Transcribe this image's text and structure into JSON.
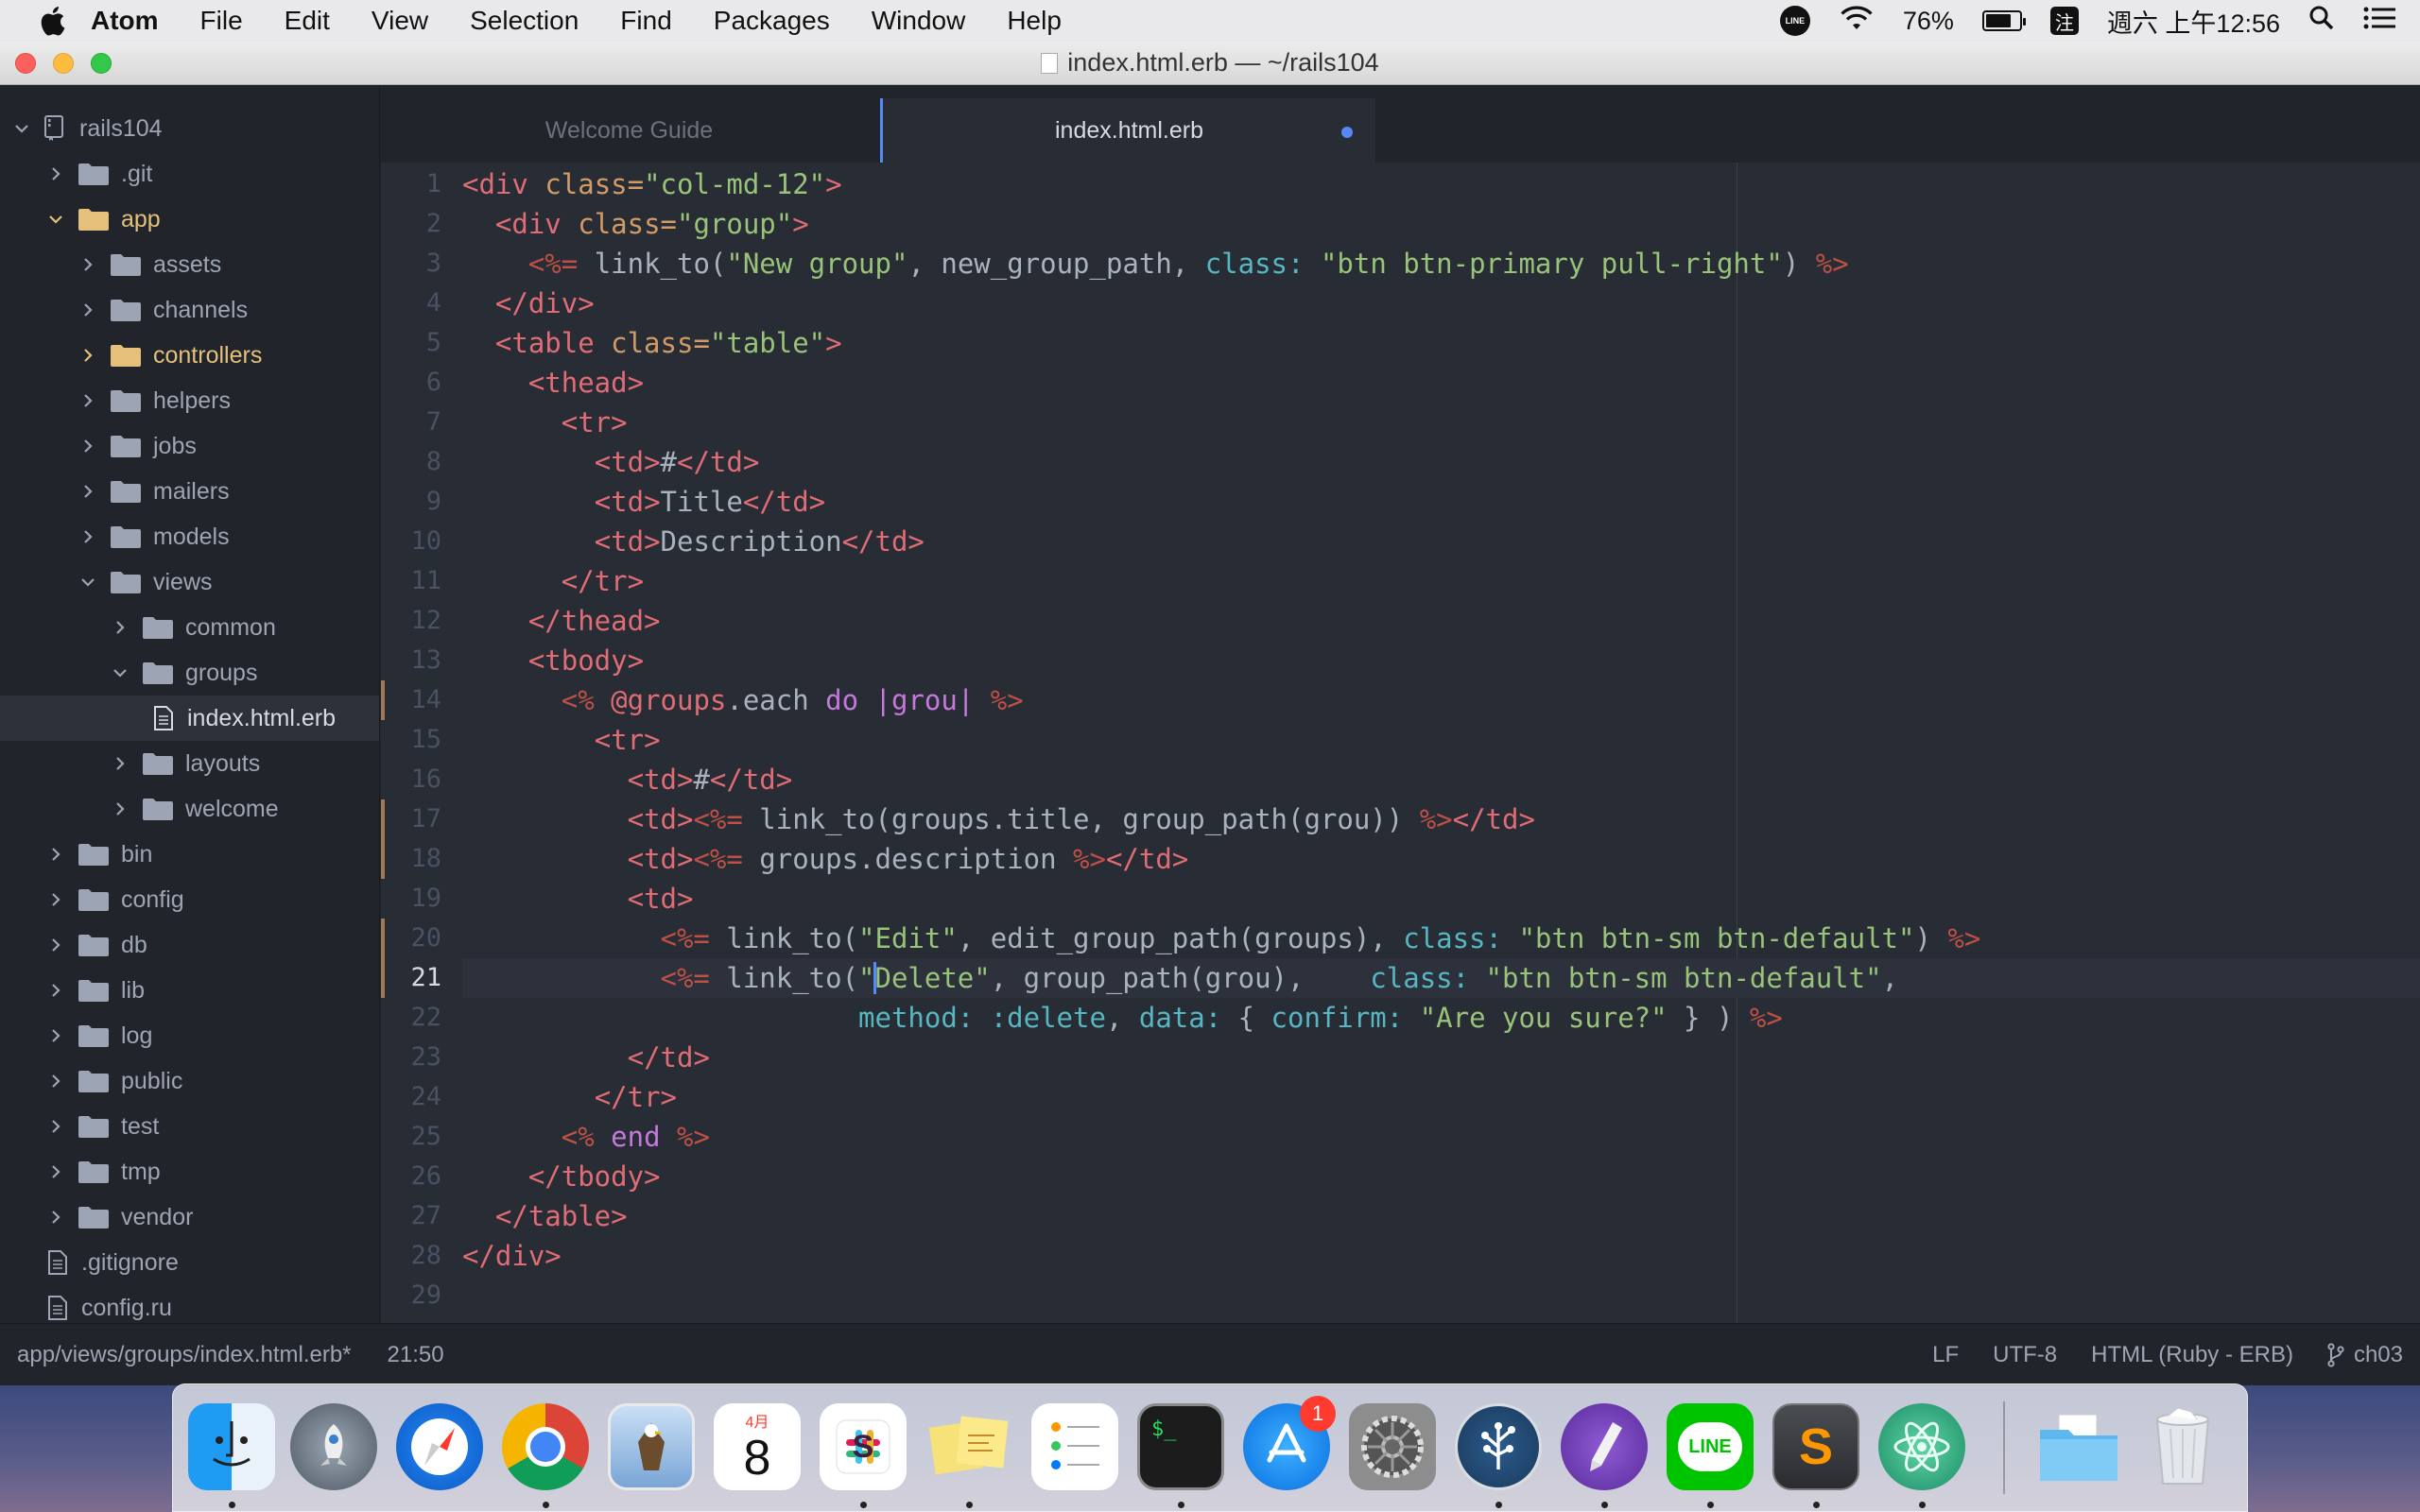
{
  "menubar": {
    "app_name": "Atom",
    "items": [
      "File",
      "Edit",
      "View",
      "Selection",
      "Find",
      "Packages",
      "Window",
      "Help"
    ],
    "status": {
      "line_icon": "LINE",
      "battery": "76%",
      "battery_level": 0.76,
      "ime": "注",
      "datetime": "週六 上午12:56"
    }
  },
  "window": {
    "title": "index.html.erb — ~/rails104"
  },
  "tree": {
    "root": "rails104",
    "items": [
      {
        "label": ".git",
        "depth": 1,
        "kind": "folder",
        "expanded": false
      },
      {
        "label": "app",
        "depth": 1,
        "kind": "folder",
        "expanded": true,
        "modified": true
      },
      {
        "label": "assets",
        "depth": 2,
        "kind": "folder",
        "expanded": false
      },
      {
        "label": "channels",
        "depth": 2,
        "kind": "folder",
        "expanded": false
      },
      {
        "label": "controllers",
        "depth": 2,
        "kind": "folder",
        "expanded": false,
        "modified": true
      },
      {
        "label": "helpers",
        "depth": 2,
        "kind": "folder",
        "expanded": false
      },
      {
        "label": "jobs",
        "depth": 2,
        "kind": "folder",
        "expanded": false
      },
      {
        "label": "mailers",
        "depth": 2,
        "kind": "folder",
        "expanded": false
      },
      {
        "label": "models",
        "depth": 2,
        "kind": "folder",
        "expanded": false
      },
      {
        "label": "views",
        "depth": 2,
        "kind": "folder",
        "expanded": true
      },
      {
        "label": "common",
        "depth": 3,
        "kind": "folder",
        "expanded": false
      },
      {
        "label": "groups",
        "depth": 3,
        "kind": "folder",
        "expanded": true
      },
      {
        "label": "index.html.erb",
        "depth": 4,
        "kind": "file",
        "selected": true
      },
      {
        "label": "layouts",
        "depth": 3,
        "kind": "folder",
        "expanded": false
      },
      {
        "label": "welcome",
        "depth": 3,
        "kind": "folder",
        "expanded": false
      },
      {
        "label": "bin",
        "depth": 1,
        "kind": "folder",
        "expanded": false
      },
      {
        "label": "config",
        "depth": 1,
        "kind": "folder",
        "expanded": false
      },
      {
        "label": "db",
        "depth": 1,
        "kind": "folder",
        "expanded": false
      },
      {
        "label": "lib",
        "depth": 1,
        "kind": "folder",
        "expanded": false
      },
      {
        "label": "log",
        "depth": 1,
        "kind": "folder",
        "expanded": false
      },
      {
        "label": "public",
        "depth": 1,
        "kind": "folder",
        "expanded": false
      },
      {
        "label": "test",
        "depth": 1,
        "kind": "folder",
        "expanded": false
      },
      {
        "label": "tmp",
        "depth": 1,
        "kind": "folder",
        "expanded": false
      },
      {
        "label": "vendor",
        "depth": 1,
        "kind": "folder",
        "expanded": false
      },
      {
        "label": ".gitignore",
        "depth": 1,
        "kind": "file"
      },
      {
        "label": "config.ru",
        "depth": 1,
        "kind": "file"
      }
    ]
  },
  "tabs": [
    {
      "label": "Welcome Guide",
      "active": false
    },
    {
      "label": "index.html.erb",
      "active": true,
      "modified": true
    }
  ],
  "editor": {
    "current_line": 21,
    "cursor_col": 25,
    "modified_lines": [
      14,
      17,
      18,
      20,
      21
    ],
    "lines": [
      [
        [
          "t",
          "<div "
        ],
        [
          "a",
          "class="
        ],
        [
          "s",
          "\"col-md-12\""
        ],
        [
          "t",
          ">"
        ]
      ],
      [
        [
          "p",
          "  "
        ],
        [
          "t",
          "<div "
        ],
        [
          "a",
          "class="
        ],
        [
          "s",
          "\"group\""
        ],
        [
          "t",
          ">"
        ]
      ],
      [
        [
          "p",
          "    "
        ],
        [
          "e",
          "<%= "
        ],
        [
          "f",
          "link_to("
        ],
        [
          "s",
          "\"New group\""
        ],
        [
          "f",
          ", new_group_path, "
        ],
        [
          "sym",
          "class: "
        ],
        [
          "s",
          "\"btn btn-primary pull-right\""
        ],
        [
          "f",
          ") "
        ],
        [
          "e",
          "%>"
        ]
      ],
      [
        [
          "p",
          "  "
        ],
        [
          "t",
          "</div>"
        ]
      ],
      [
        [
          "p",
          "  "
        ],
        [
          "t",
          "<table "
        ],
        [
          "a",
          "class="
        ],
        [
          "s",
          "\"table\""
        ],
        [
          "t",
          ">"
        ]
      ],
      [
        [
          "p",
          "    "
        ],
        [
          "t",
          "<thead>"
        ]
      ],
      [
        [
          "p",
          "      "
        ],
        [
          "t",
          "<tr>"
        ]
      ],
      [
        [
          "p",
          "        "
        ],
        [
          "t",
          "<td>"
        ],
        [
          "p",
          "#"
        ],
        [
          "t",
          "</td>"
        ]
      ],
      [
        [
          "p",
          "        "
        ],
        [
          "t",
          "<td>"
        ],
        [
          "p",
          "Title"
        ],
        [
          "t",
          "</td>"
        ]
      ],
      [
        [
          "p",
          "        "
        ],
        [
          "t",
          "<td>"
        ],
        [
          "p",
          "Description"
        ],
        [
          "t",
          "</td>"
        ]
      ],
      [
        [
          "p",
          "      "
        ],
        [
          "t",
          "</tr>"
        ]
      ],
      [
        [
          "p",
          "    "
        ],
        [
          "t",
          "</thead>"
        ]
      ],
      [
        [
          "p",
          "    "
        ],
        [
          "t",
          "<tbody>"
        ]
      ],
      [
        [
          "p",
          "      "
        ],
        [
          "e",
          "<% "
        ],
        [
          "iv",
          "@groups"
        ],
        [
          "f",
          ".each "
        ],
        [
          "k",
          "do |grou| "
        ],
        [
          "e",
          "%>"
        ]
      ],
      [
        [
          "p",
          "        "
        ],
        [
          "t",
          "<tr>"
        ]
      ],
      [
        [
          "p",
          "          "
        ],
        [
          "t",
          "<td>"
        ],
        [
          "p",
          "#"
        ],
        [
          "t",
          "</td>"
        ]
      ],
      [
        [
          "p",
          "          "
        ],
        [
          "t",
          "<td>"
        ],
        [
          "e",
          "<%= "
        ],
        [
          "f",
          "link_to(groups.title, group_path(grou)) "
        ],
        [
          "e",
          "%>"
        ],
        [
          "t",
          "</td>"
        ]
      ],
      [
        [
          "p",
          "          "
        ],
        [
          "t",
          "<td>"
        ],
        [
          "e",
          "<%= "
        ],
        [
          "f",
          "groups.description "
        ],
        [
          "e",
          "%>"
        ],
        [
          "t",
          "</td>"
        ]
      ],
      [
        [
          "p",
          "          "
        ],
        [
          "t",
          "<td>"
        ]
      ],
      [
        [
          "p",
          "            "
        ],
        [
          "e",
          "<%= "
        ],
        [
          "f",
          "link_to("
        ],
        [
          "s",
          "\"Edit\""
        ],
        [
          "f",
          ", edit_group_path(groups), "
        ],
        [
          "sym",
          "class: "
        ],
        [
          "s",
          "\"btn btn-sm btn-default\""
        ],
        [
          "f",
          ") "
        ],
        [
          "e",
          "%>"
        ]
      ],
      [
        [
          "p",
          "            "
        ],
        [
          "e",
          "<%= "
        ],
        [
          "f",
          "link_to("
        ],
        [
          "s",
          "\"Delete\""
        ],
        [
          "f",
          ", group_path(grou),    "
        ],
        [
          "sym",
          "class: "
        ],
        [
          "s",
          "\"btn btn-sm btn-default\""
        ],
        [
          "f",
          ","
        ]
      ],
      [
        [
          "p",
          "                        "
        ],
        [
          "sym",
          "method: "
        ],
        [
          "sym",
          ":delete"
        ],
        [
          "f",
          ", "
        ],
        [
          "sym",
          "data: "
        ],
        [
          "f",
          "{ "
        ],
        [
          "sym",
          "confirm: "
        ],
        [
          "s",
          "\"Are you sure?\""
        ],
        [
          "f",
          " } ) "
        ],
        [
          "e",
          "%>"
        ]
      ],
      [
        [
          "p",
          "          "
        ],
        [
          "t",
          "</td>"
        ]
      ],
      [
        [
          "p",
          "        "
        ],
        [
          "t",
          "</tr>"
        ]
      ],
      [
        [
          "p",
          "      "
        ],
        [
          "e",
          "<% "
        ],
        [
          "k",
          "end "
        ],
        [
          "e",
          "%>"
        ]
      ],
      [
        [
          "p",
          "    "
        ],
        [
          "t",
          "</tbody>"
        ]
      ],
      [
        [
          "p",
          "  "
        ],
        [
          "t",
          "</table>"
        ]
      ],
      [
        [
          "t",
          "</div>"
        ]
      ],
      []
    ]
  },
  "statusbar": {
    "path": "app/views/groups/index.html.erb*",
    "position": "21:50",
    "line_ending": "LF",
    "encoding": "UTF-8",
    "grammar": "HTML (Ruby - ERB)",
    "branch": "ch03"
  },
  "dock": {
    "apps": [
      {
        "name": "finder",
        "running": true
      },
      {
        "name": "launchpad",
        "running": false
      },
      {
        "name": "safari",
        "running": false
      },
      {
        "name": "chrome",
        "running": true
      },
      {
        "name": "preview",
        "running": false
      },
      {
        "name": "calendar",
        "running": false,
        "month": "4月",
        "day": "8"
      },
      {
        "name": "slack",
        "running": true
      },
      {
        "name": "stickies",
        "running": true
      },
      {
        "name": "reminders",
        "running": false
      },
      {
        "name": "terminal",
        "running": true,
        "text": "$_"
      },
      {
        "name": "app-store",
        "running": false,
        "badge": "1"
      },
      {
        "name": "system-preferences",
        "running": false
      },
      {
        "name": "sourcetree",
        "running": true
      },
      {
        "name": "pencil-app",
        "running": true
      },
      {
        "name": "line",
        "running": true,
        "text": "LINE"
      },
      {
        "name": "sublime-text",
        "running": true,
        "text": "S"
      },
      {
        "name": "atom",
        "running": true
      },
      {
        "name": "downloads-folder",
        "running": false
      },
      {
        "name": "trash",
        "running": false
      }
    ]
  }
}
